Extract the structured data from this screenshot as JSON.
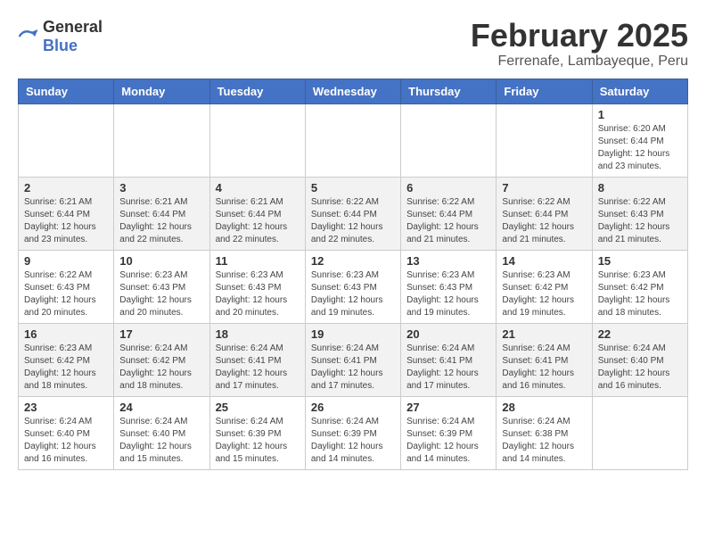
{
  "header": {
    "logo_general": "General",
    "logo_blue": "Blue",
    "title": "February 2025",
    "subtitle": "Ferrenafe, Lambayeque, Peru"
  },
  "weekdays": [
    "Sunday",
    "Monday",
    "Tuesday",
    "Wednesday",
    "Thursday",
    "Friday",
    "Saturday"
  ],
  "weeks": [
    [
      {
        "day": "",
        "info": ""
      },
      {
        "day": "",
        "info": ""
      },
      {
        "day": "",
        "info": ""
      },
      {
        "day": "",
        "info": ""
      },
      {
        "day": "",
        "info": ""
      },
      {
        "day": "",
        "info": ""
      },
      {
        "day": "1",
        "info": "Sunrise: 6:20 AM\nSunset: 6:44 PM\nDaylight: 12 hours and 23 minutes."
      }
    ],
    [
      {
        "day": "2",
        "info": "Sunrise: 6:21 AM\nSunset: 6:44 PM\nDaylight: 12 hours and 23 minutes."
      },
      {
        "day": "3",
        "info": "Sunrise: 6:21 AM\nSunset: 6:44 PM\nDaylight: 12 hours and 22 minutes."
      },
      {
        "day": "4",
        "info": "Sunrise: 6:21 AM\nSunset: 6:44 PM\nDaylight: 12 hours and 22 minutes."
      },
      {
        "day": "5",
        "info": "Sunrise: 6:22 AM\nSunset: 6:44 PM\nDaylight: 12 hours and 22 minutes."
      },
      {
        "day": "6",
        "info": "Sunrise: 6:22 AM\nSunset: 6:44 PM\nDaylight: 12 hours and 21 minutes."
      },
      {
        "day": "7",
        "info": "Sunrise: 6:22 AM\nSunset: 6:44 PM\nDaylight: 12 hours and 21 minutes."
      },
      {
        "day": "8",
        "info": "Sunrise: 6:22 AM\nSunset: 6:43 PM\nDaylight: 12 hours and 21 minutes."
      }
    ],
    [
      {
        "day": "9",
        "info": "Sunrise: 6:22 AM\nSunset: 6:43 PM\nDaylight: 12 hours and 20 minutes."
      },
      {
        "day": "10",
        "info": "Sunrise: 6:23 AM\nSunset: 6:43 PM\nDaylight: 12 hours and 20 minutes."
      },
      {
        "day": "11",
        "info": "Sunrise: 6:23 AM\nSunset: 6:43 PM\nDaylight: 12 hours and 20 minutes."
      },
      {
        "day": "12",
        "info": "Sunrise: 6:23 AM\nSunset: 6:43 PM\nDaylight: 12 hours and 19 minutes."
      },
      {
        "day": "13",
        "info": "Sunrise: 6:23 AM\nSunset: 6:43 PM\nDaylight: 12 hours and 19 minutes."
      },
      {
        "day": "14",
        "info": "Sunrise: 6:23 AM\nSunset: 6:42 PM\nDaylight: 12 hours and 19 minutes."
      },
      {
        "day": "15",
        "info": "Sunrise: 6:23 AM\nSunset: 6:42 PM\nDaylight: 12 hours and 18 minutes."
      }
    ],
    [
      {
        "day": "16",
        "info": "Sunrise: 6:23 AM\nSunset: 6:42 PM\nDaylight: 12 hours and 18 minutes."
      },
      {
        "day": "17",
        "info": "Sunrise: 6:24 AM\nSunset: 6:42 PM\nDaylight: 12 hours and 18 minutes."
      },
      {
        "day": "18",
        "info": "Sunrise: 6:24 AM\nSunset: 6:41 PM\nDaylight: 12 hours and 17 minutes."
      },
      {
        "day": "19",
        "info": "Sunrise: 6:24 AM\nSunset: 6:41 PM\nDaylight: 12 hours and 17 minutes."
      },
      {
        "day": "20",
        "info": "Sunrise: 6:24 AM\nSunset: 6:41 PM\nDaylight: 12 hours and 17 minutes."
      },
      {
        "day": "21",
        "info": "Sunrise: 6:24 AM\nSunset: 6:41 PM\nDaylight: 12 hours and 16 minutes."
      },
      {
        "day": "22",
        "info": "Sunrise: 6:24 AM\nSunset: 6:40 PM\nDaylight: 12 hours and 16 minutes."
      }
    ],
    [
      {
        "day": "23",
        "info": "Sunrise: 6:24 AM\nSunset: 6:40 PM\nDaylight: 12 hours and 16 minutes."
      },
      {
        "day": "24",
        "info": "Sunrise: 6:24 AM\nSunset: 6:40 PM\nDaylight: 12 hours and 15 minutes."
      },
      {
        "day": "25",
        "info": "Sunrise: 6:24 AM\nSunset: 6:39 PM\nDaylight: 12 hours and 15 minutes."
      },
      {
        "day": "26",
        "info": "Sunrise: 6:24 AM\nSunset: 6:39 PM\nDaylight: 12 hours and 14 minutes."
      },
      {
        "day": "27",
        "info": "Sunrise: 6:24 AM\nSunset: 6:39 PM\nDaylight: 12 hours and 14 minutes."
      },
      {
        "day": "28",
        "info": "Sunrise: 6:24 AM\nSunset: 6:38 PM\nDaylight: 12 hours and 14 minutes."
      },
      {
        "day": "",
        "info": ""
      }
    ]
  ]
}
